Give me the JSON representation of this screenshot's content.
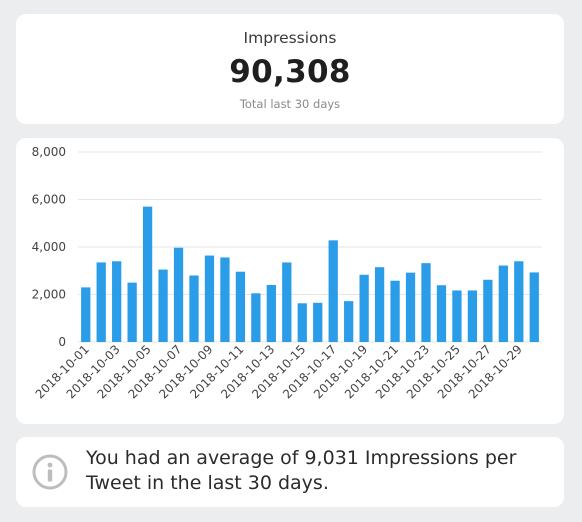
{
  "kpi": {
    "title": "Impressions",
    "value": "90,308",
    "subtitle": "Total last 30 days"
  },
  "info": {
    "icon": "info-icon",
    "message": "You had an average of 9,031 Impressions per Tweet in the last 30 days."
  },
  "colors": {
    "bar": "#2b9de8",
    "grid": "#e6e6e6",
    "background": "#ecedef"
  },
  "chart_data": {
    "type": "bar",
    "categories": [
      "2018-10-01",
      "2018-10-02",
      "2018-10-03",
      "2018-10-04",
      "2018-10-05",
      "2018-10-06",
      "2018-10-07",
      "2018-10-08",
      "2018-10-09",
      "2018-10-10",
      "2018-10-11",
      "2018-10-12",
      "2018-10-13",
      "2018-10-14",
      "2018-10-15",
      "2018-10-16",
      "2018-10-17",
      "2018-10-18",
      "2018-10-19",
      "2018-10-20",
      "2018-10-21",
      "2018-10-22",
      "2018-10-23",
      "2018-10-24",
      "2018-10-25",
      "2018-10-26",
      "2018-10-27",
      "2018-10-28",
      "2018-10-29",
      "2018-10-30"
    ],
    "values": [
      2300,
      3350,
      3400,
      2500,
      5700,
      3050,
      3970,
      2800,
      3640,
      3560,
      2960,
      2050,
      2400,
      3350,
      1630,
      1650,
      4280,
      1720,
      2830,
      3150,
      2580,
      2920,
      3320,
      2390,
      2170,
      2170,
      2620,
      3220,
      3400,
      2930
    ],
    "tick_labels": [
      "2018-10-01",
      "2018-10-03",
      "2018-10-05",
      "2018-10-07",
      "2018-10-09",
      "2018-10-11",
      "2018-10-13",
      "2018-10-15",
      "2018-10-17",
      "2018-10-19",
      "2018-10-21",
      "2018-10-23",
      "2018-10-25",
      "2018-10-27",
      "2018-10-29"
    ],
    "y_ticks": [
      "0",
      "2,000",
      "4,000",
      "6,000",
      "8,000"
    ],
    "ylim": [
      0,
      8000
    ],
    "grid": true,
    "legend": "none"
  }
}
